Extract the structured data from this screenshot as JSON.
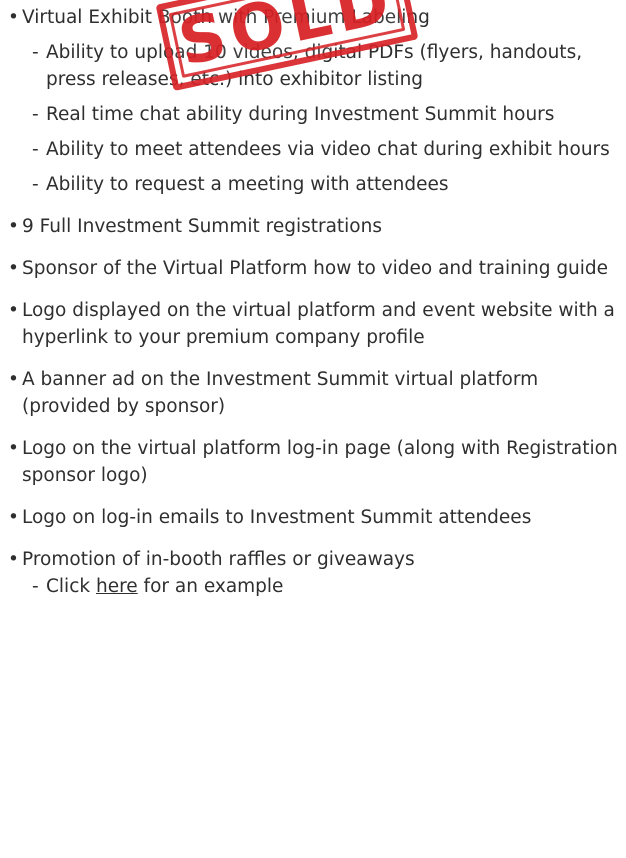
{
  "bullet_char": "•",
  "dash_char": "-",
  "items": [
    {
      "text": "Virtual Exhibit Booth with Premium Labeling",
      "subs": [
        "Ability to upload 10 videos, digital PDFs (flyers, handouts, press releases, etc.) into exhibitor listing",
        "Real time chat ability during Investment Summit hours",
        "Ability to meet attendees via video chat during exhibit hours",
        "Ability to request a meeting with attendees"
      ]
    },
    {
      "text": "9 Full Investment Summit registrations"
    },
    {
      "text": "Sponsor of the Virtual Platform how to video and training guide"
    },
    {
      "text": "Logo displayed on the virtual platform and event website with a hyperlink to your premium company profile"
    },
    {
      "text": "A banner ad on the Investment Summit virtual platform (provided by sponsor)"
    },
    {
      "text": "Logo on the virtual platform log-in page (along with Registration sponsor logo)"
    },
    {
      "text": "Logo on log-in emails to Investment Summit attendees"
    },
    {
      "text": "Promotion of in-booth raffles or giveaways"
    }
  ],
  "last_sub": {
    "prefix": "Click ",
    "link_text": "here",
    "suffix": " for an example"
  },
  "stamp": {
    "text": "SOLD",
    "color": "#d71e23"
  }
}
